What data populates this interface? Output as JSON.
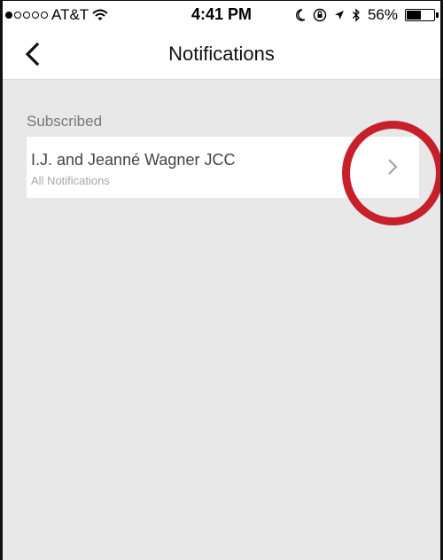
{
  "status_bar": {
    "carrier": "AT&T",
    "time": "4:41 PM",
    "battery": "56%",
    "battery_level": 0.56,
    "signal_bars_filled": 1,
    "signal_bars_total": 5,
    "icons": [
      "wifi-icon",
      "moon-icon",
      "rotation-lock-icon",
      "location-arrow-icon",
      "bluetooth-icon",
      "battery-icon"
    ]
  },
  "nav": {
    "title": "Notifications",
    "back_icon": "chevron-left-icon"
  },
  "subscribed": {
    "header": "Subscribed",
    "items": [
      {
        "title": "I.J. and Jeanné Wagner JCC",
        "subtitle": "All Notifications",
        "icon": "chevron-right-icon"
      }
    ]
  },
  "colors": {
    "background": "#e8e8e8",
    "card": "#ffffff",
    "highlight_ring": "#c8202a",
    "header_text": "#7a7a7a",
    "subtitle_text": "#a8a8a8"
  }
}
